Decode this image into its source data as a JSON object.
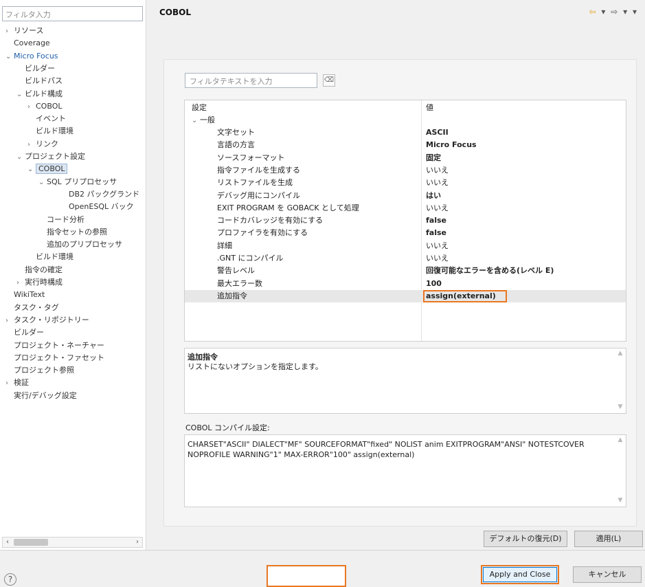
{
  "left_panel": {
    "filter_placeholder": "フィルタ入力",
    "tree": [
      {
        "label": "リソース",
        "depth": 0,
        "twisty": "›"
      },
      {
        "label": "Coverage",
        "depth": 0,
        "twisty": ""
      },
      {
        "label": "Micro Focus",
        "depth": 0,
        "twisty": "⌄",
        "link": true
      },
      {
        "label": "ビルダー",
        "depth": 1,
        "twisty": ""
      },
      {
        "label": "ビルドパス",
        "depth": 1,
        "twisty": ""
      },
      {
        "label": "ビルド構成",
        "depth": 1,
        "twisty": "⌄"
      },
      {
        "label": "COBOL",
        "depth": 2,
        "twisty": "›"
      },
      {
        "label": "イベント",
        "depth": 2,
        "twisty": ""
      },
      {
        "label": "ビルド環境",
        "depth": 2,
        "twisty": ""
      },
      {
        "label": "リンク",
        "depth": 2,
        "twisty": "›"
      },
      {
        "label": "プロジェクト設定",
        "depth": 1,
        "twisty": "⌄"
      },
      {
        "label": "COBOL",
        "depth": 2,
        "twisty": "⌄",
        "selected": true
      },
      {
        "label": "SQL プリプロセッサ",
        "depth": 3,
        "twisty": "⌄"
      },
      {
        "label": "DB2 パックグランド",
        "depth": 5,
        "twisty": ""
      },
      {
        "label": "OpenESQL バック",
        "depth": 5,
        "twisty": ""
      },
      {
        "label": "コード分析",
        "depth": 3,
        "twisty": ""
      },
      {
        "label": "指令セットの参照",
        "depth": 3,
        "twisty": ""
      },
      {
        "label": "追加のプリプロセッサ",
        "depth": 3,
        "twisty": ""
      },
      {
        "label": "ビルド環境",
        "depth": 2,
        "twisty": ""
      },
      {
        "label": "指令の確定",
        "depth": 1,
        "twisty": ""
      },
      {
        "label": "実行時構成",
        "depth": 1,
        "twisty": "›"
      },
      {
        "label": "WikiText",
        "depth": 0,
        "twisty": ""
      },
      {
        "label": "タスク・タグ",
        "depth": 0,
        "twisty": ""
      },
      {
        "label": "タスク・リポジトリー",
        "depth": 0,
        "twisty": "›"
      },
      {
        "label": "ビルダー",
        "depth": 0,
        "twisty": ""
      },
      {
        "label": "プロジェクト・ネーチャー",
        "depth": 0,
        "twisty": ""
      },
      {
        "label": "プロジェクト・ファセット",
        "depth": 0,
        "twisty": ""
      },
      {
        "label": "プロジェクト参照",
        "depth": 0,
        "twisty": ""
      },
      {
        "label": "検証",
        "depth": 0,
        "twisty": "›"
      },
      {
        "label": "実行/デバッグ設定",
        "depth": 0,
        "twisty": ""
      }
    ]
  },
  "header": {
    "title": "COBOL",
    "nav": {
      "back": "⇦",
      "back_menu": "▾",
      "forward": "⇨",
      "forward_menu": "▾",
      "view_menu": "▾"
    }
  },
  "main": {
    "filter_placeholder": "フィルタテキストを入力",
    "clear_icon": "⌫",
    "table_header": {
      "name": "設定",
      "value": "値"
    },
    "group": {
      "label": "一般",
      "twisty": "⌄"
    },
    "rows": [
      {
        "name": "文字セット",
        "value": "ASCII",
        "bold": true
      },
      {
        "name": "言語の方言",
        "value": "Micro Focus",
        "bold": true
      },
      {
        "name": "ソースフォーマット",
        "value": "固定",
        "bold": true
      },
      {
        "name": "指令ファイルを生成する",
        "value": "いいえ",
        "bold": false
      },
      {
        "name": "リストファイルを生成",
        "value": "いいえ",
        "bold": false
      },
      {
        "name": "デバッグ用にコンパイル",
        "value": "はい",
        "bold": true
      },
      {
        "name": "EXIT PROGRAM を GOBACK として処理",
        "value": "いいえ",
        "bold": false
      },
      {
        "name": "コードカバレッジを有効にする",
        "value": "false",
        "bold": true
      },
      {
        "name": "プロファイラを有効にする",
        "value": "false",
        "bold": true
      },
      {
        "name": "詳細",
        "value": "いいえ",
        "bold": false
      },
      {
        "name": ".GNT にコンパイル",
        "value": "いいえ",
        "bold": false
      },
      {
        "name": "警告レベル",
        "value": "回復可能なエラーを含める(レベル E)",
        "bold": true
      },
      {
        "name": "最大エラー数",
        "value": "100",
        "bold": true
      },
      {
        "name": "追加指令",
        "value": "assign(external)",
        "bold": true,
        "highlighted": true
      }
    ],
    "description": {
      "title": "追加指令",
      "text": "リストにないオプションを指定します。"
    },
    "compile_label": "COBOL コンパイル設定:",
    "compile_text": "CHARSET\"ASCII\" DIALECT\"MF\" SOURCEFORMAT\"fixed\" NOLIST anim EXITPROGRAM\"ANSI\" NOTESTCOVER NOPROFILE WARNING\"1\" MAX-ERROR\"100\" assign(external)",
    "restore_defaults_label": "デフォルトの復元(D)",
    "apply_label": "適用(L)"
  },
  "footer": {
    "help_icon": "?",
    "apply_close_label": "Apply and Close",
    "cancel_label": "キャンセル"
  },
  "colors": {
    "highlight": "#e87722",
    "selection": "#dce7f3",
    "link": "#1f5fa8"
  }
}
